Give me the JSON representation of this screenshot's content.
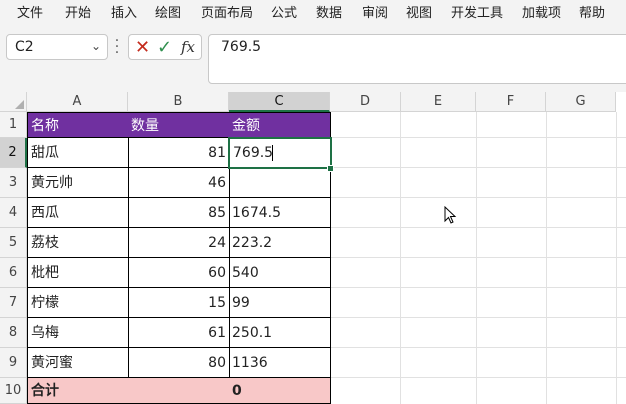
{
  "menu": [
    "文件",
    "开始",
    "插入",
    "绘图",
    "页面布局",
    "公式",
    "数据",
    "审阅",
    "视图",
    "开发工具",
    "加载项",
    "帮助"
  ],
  "namebox": {
    "value": "C2"
  },
  "formula": {
    "value": "769.5"
  },
  "columns": [
    "A",
    "B",
    "C",
    "D",
    "E",
    "F",
    "G"
  ],
  "rows": [
    "1",
    "2",
    "3",
    "4",
    "5",
    "6",
    "7",
    "8",
    "9",
    "10"
  ],
  "table": {
    "headers": [
      "名称",
      "数量",
      "金额"
    ],
    "body": [
      [
        "甜瓜",
        "81",
        "769.5"
      ],
      [
        "黄元帅",
        "46",
        ""
      ],
      [
        "西瓜",
        "85",
        "1674.5"
      ],
      [
        "荔枝",
        "24",
        "223.2"
      ],
      [
        "枇杷",
        "60",
        "540"
      ],
      [
        "柠檬",
        "15",
        "99"
      ],
      [
        "乌梅",
        "61",
        "250.1"
      ],
      [
        "黄河蜜",
        "80",
        "1136"
      ]
    ],
    "total": [
      "合计",
      "",
      "0"
    ]
  },
  "colors": {
    "header_bg": "#7030a0",
    "total_bg": "#f8c8c8",
    "selection": "#1e7145"
  }
}
